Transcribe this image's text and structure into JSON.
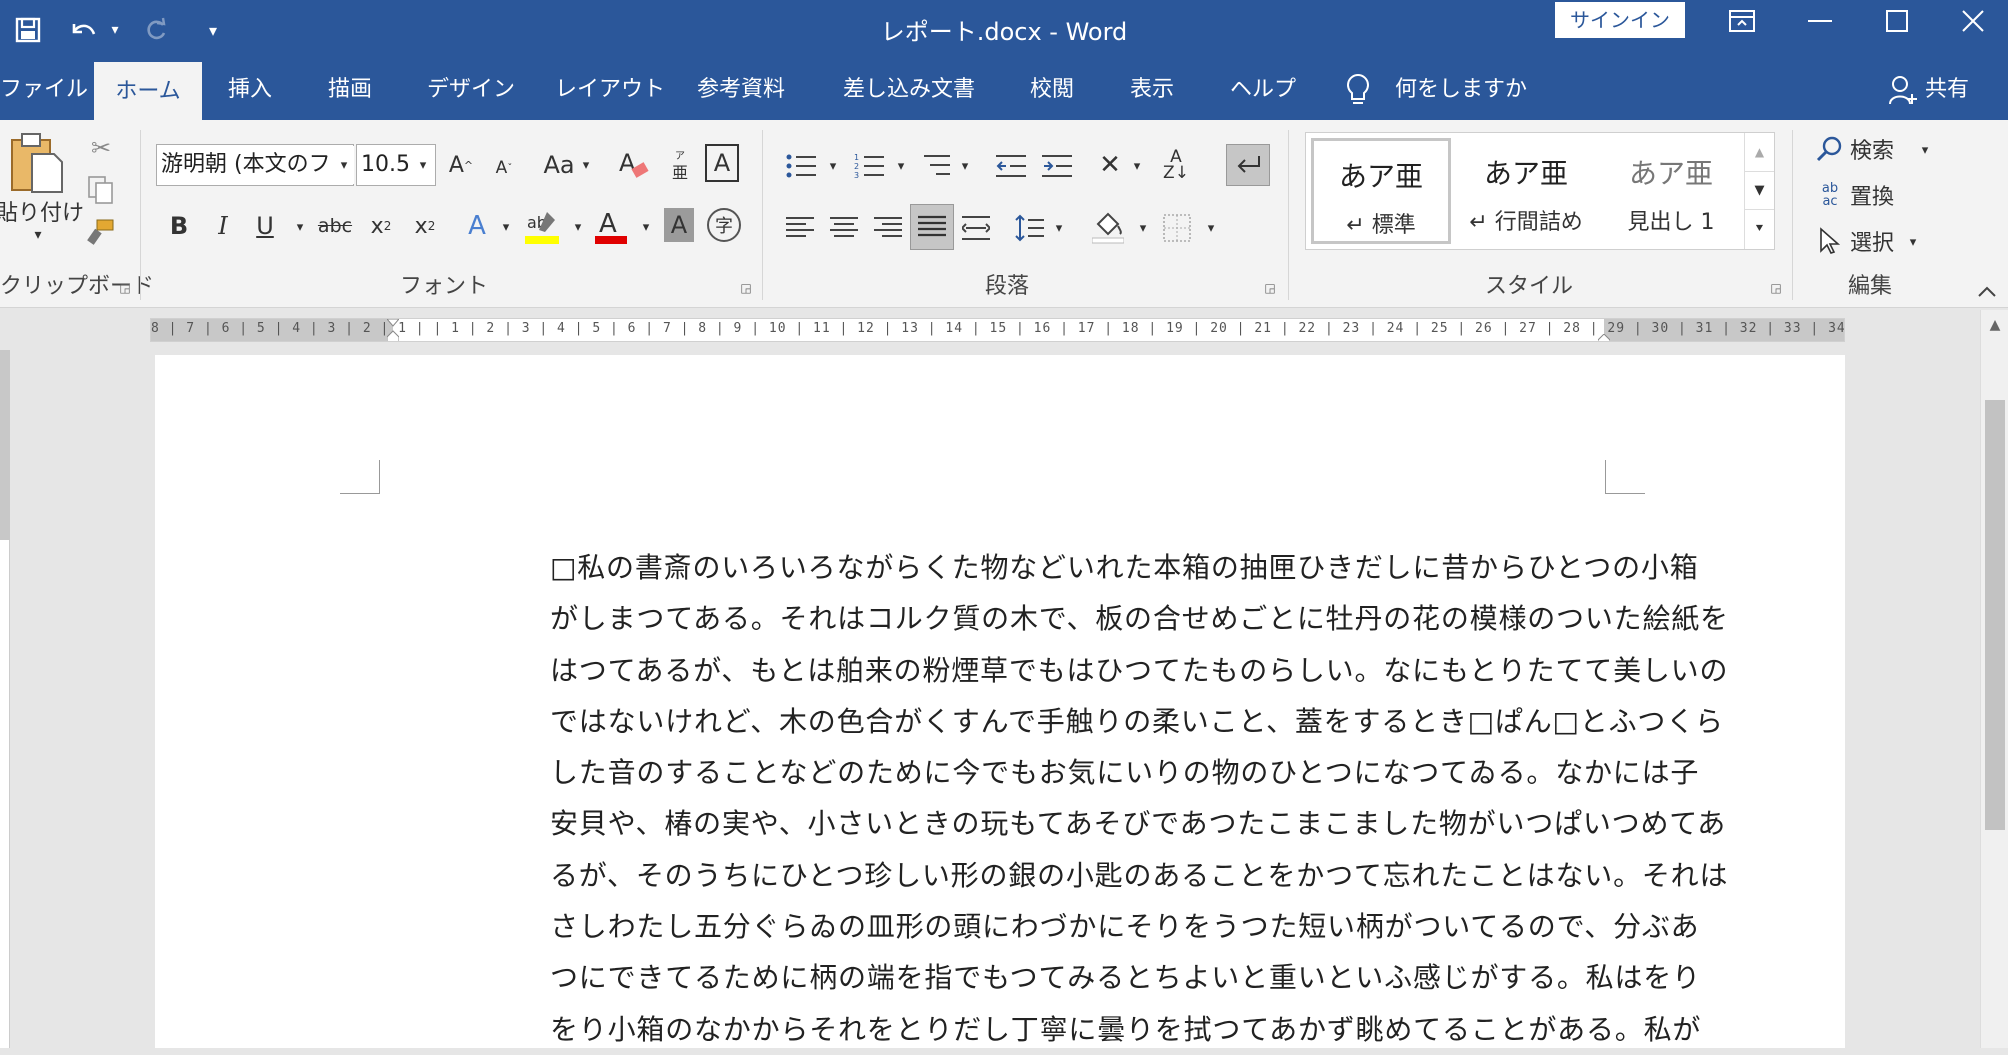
{
  "title_bar": {
    "window_title": "レポート.docx  -  Word",
    "signin_label": "サインイン",
    "customize_label": "▾"
  },
  "tabs": [
    "ファイル",
    "ホーム",
    "挿入",
    "描画",
    "デザイン",
    "レイアウト",
    "参考資料",
    "差し込み文書",
    "校閲",
    "表示",
    "ヘルプ"
  ],
  "active_tab": "ホーム",
  "tell_me": "何をしますか",
  "share_label": "共有",
  "ribbon": {
    "clipboard": {
      "paste_label": "貼り付け",
      "group_label": "クリップボード"
    },
    "font": {
      "font_name": "游明朝 (本文のフ",
      "font_size": "10.5",
      "case_label": "Aa",
      "group_label": "フォント"
    },
    "paragraph": {
      "group_label": "段落"
    },
    "styles": {
      "items": [
        {
          "preview": "あア亜",
          "name": "↵ 標準"
        },
        {
          "preview": "あア亜",
          "name": "↵ 行間詰め"
        },
        {
          "preview": "あア亜",
          "name": "見出し 1"
        }
      ],
      "group_label": "スタイル"
    },
    "editing": {
      "find_label": "検索",
      "replace_label": "置換",
      "select_label": "選択",
      "group_label": "編集"
    }
  },
  "ruler": {
    "text": "8 | 7 | 6 | 5 | 4 | 3 | 2 | 1 |  | 1 | 2 | 3 | 4 | 5 | 6 | 7 | 8 | 9 | 10 | 11 | 12 | 13 | 14 | 15 | 16 | 17 | 18 | 19 | 20 | 21 | 22 | 23 | 24 | 25 | 26 | 27 | 28 | 29 | 30 | 31 | 32 | 33 | 34 | 35 | 36 | 37 | 38 | 39 | 40 | 41 | 42 | 43 | 44 | 45 | 46 | 47 | 48"
  },
  "document": {
    "lines": [
      "□私の書斎のいろいろながらくた物などいれた本箱の抽匣ひきだしに昔からひとつの小箱",
      "がしまつてある。それはコルク質の木で、板の合せめごとに牡丹の花の模様のついた絵紙を",
      "はつてあるが、もとは舶来の粉煙草でもはひつてたものらしい。なにもとりたてて美しいの",
      "ではないけれど、木の色合がくすんで手触りの柔いこと、蓋をするとき□ぱん□とふつくら",
      "した音のすることなどのために今でもお気にいりの物のひとつになつてゐる。なかには子",
      "安貝や、椿の実や、小さいときの玩もてあそびであつたこまこました物がいつぱいつめてあ",
      "るが、そのうちにひとつ珍しい形の銀の小匙のあることをかつて忘れたことはない。それは",
      "さしわたし五分ぐらゐの皿形の頭にわづかにそりをうつた短い柄がついてるので、分ぶあ",
      "つにできてるために柄の端を指でもつてみるとちよいと重いといふ感じがする。私はをり",
      "をり小箱のなかからそれをとりだし丁寧に曇りを拭つてあかず眺めてることがある。私が"
    ]
  }
}
